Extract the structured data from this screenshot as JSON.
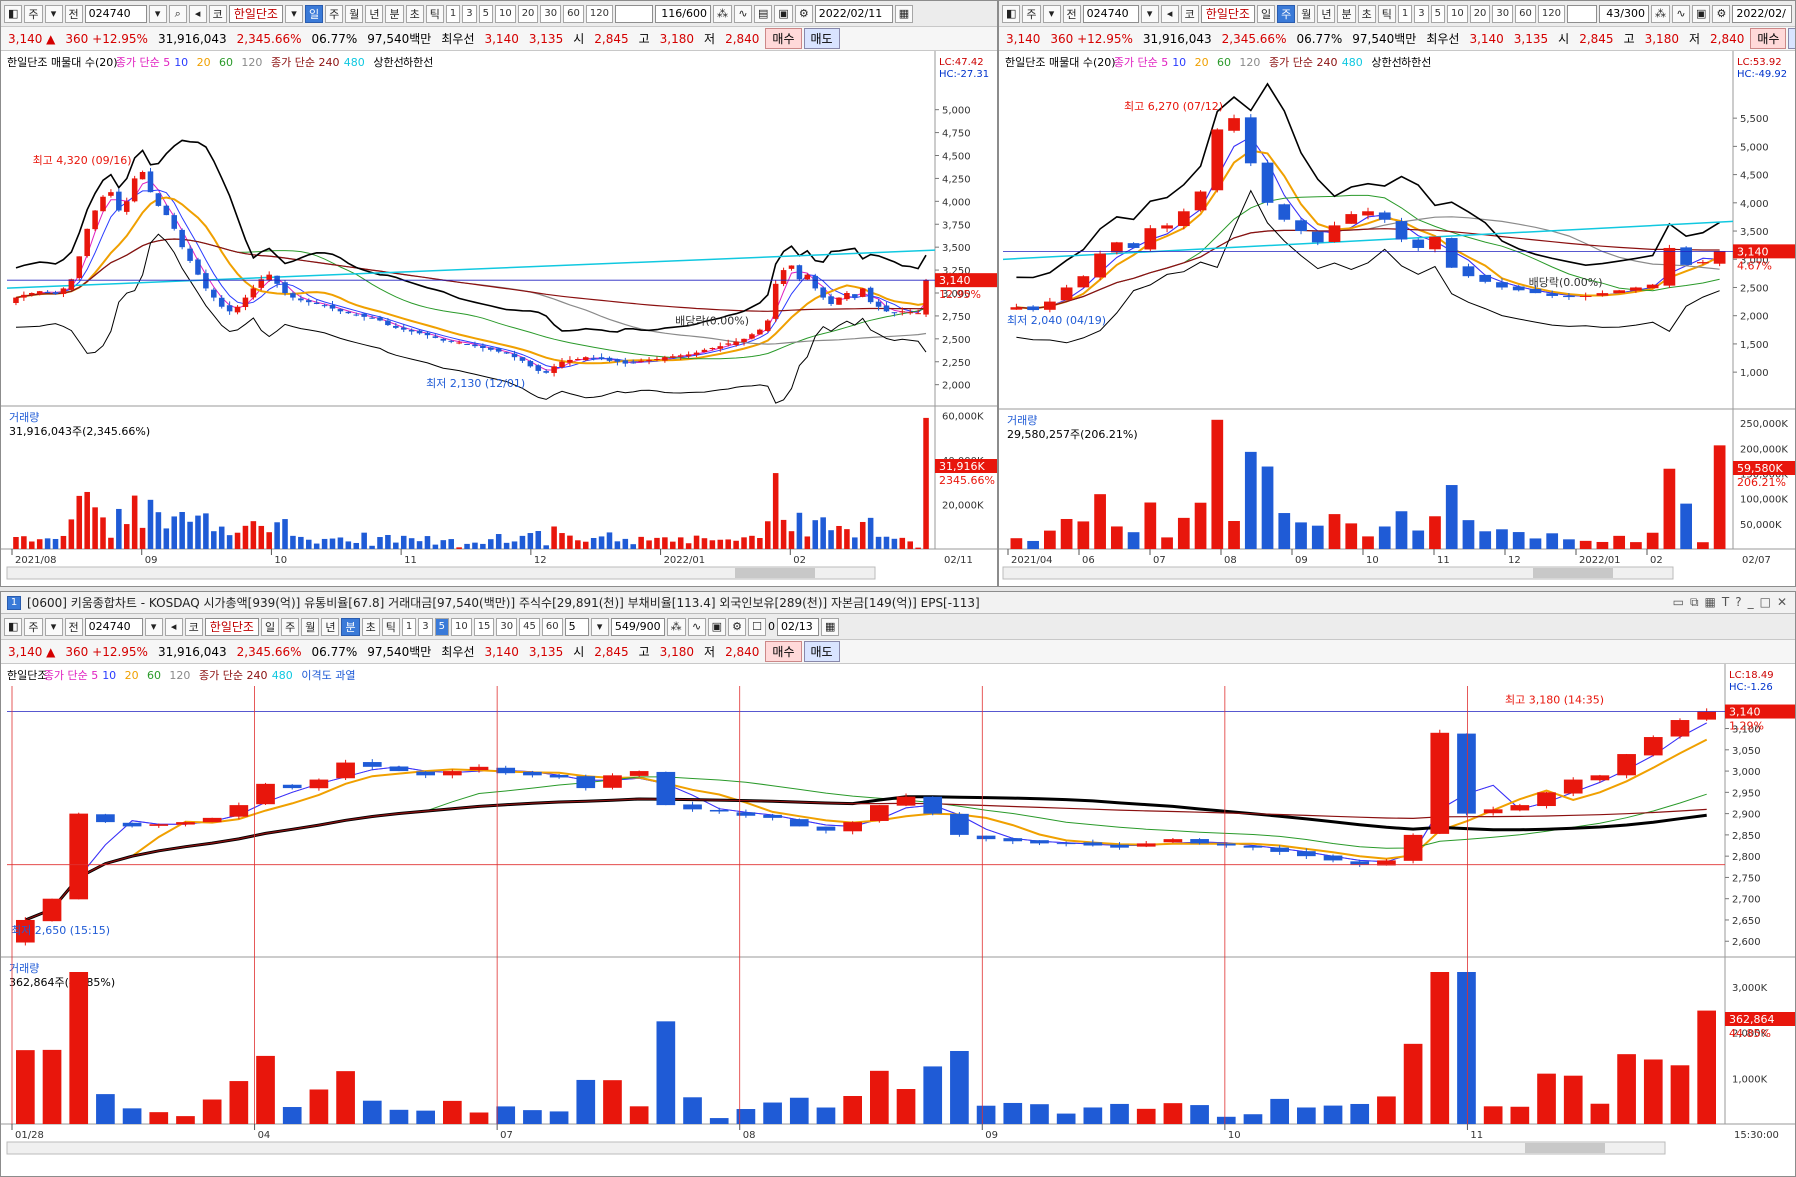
{
  "quote": {
    "price": "3,140",
    "change": "360",
    "change_pct": "+12.95%",
    "volume": "31,916,043",
    "vol_ratio": "2,345.66%",
    "turnover": "06.77%",
    "amount": "97,540백만",
    "best_label": "최우선",
    "ask": "3,140",
    "bid": "3,135",
    "open_label": "시",
    "open": "2,845",
    "high_label": "고",
    "high": "3,180",
    "low_label": "저",
    "low": "2,840",
    "buy": "매수",
    "sell": "매도"
  },
  "toolbar": {
    "main": "주",
    "all": "전",
    "code": "024740",
    "market": "코",
    "name": "한일단조",
    "periods": [
      "일",
      "주",
      "월",
      "년",
      "분",
      "초",
      "틱"
    ],
    "nums_w1": [
      "1",
      "3",
      "5",
      "10",
      "20",
      "30",
      "60",
      "120"
    ],
    "nums_w3": [
      "1",
      "3",
      "5",
      "10",
      "15",
      "30",
      "45",
      "60"
    ]
  },
  "win1": {
    "count": "116/600",
    "date": "2022/02/11"
  },
  "win2": {
    "count": "43/300",
    "date": "2022/02/"
  },
  "win3": {
    "count": "549/900",
    "date": "02/13",
    "interval": "5",
    "check": "0"
  },
  "title_bar": {
    "num": "1",
    "text": "[0600] 키움종합차트 - KOSDAQ 시가총액[939(억)] 유통비율[67.8] 거래대금[97,540(백만)] 주식수[29,891(천)] 부채비율[113.4] 외국인보유[289(천)] 자본금[149(억)] EPS[-113]"
  },
  "colors": {
    "up": "#e8160c",
    "down": "#1f5bd6",
    "ma5": "#e020c0",
    "ma10": "#2a3cff",
    "ma20": "#f0a000",
    "ma60": "#2a9a2a",
    "ma120": "#8a8a8a",
    "ma240": "#8b1010",
    "ma480": "#10c8e0",
    "bb": "#000000"
  },
  "chart_data": [
    {
      "type": "candlestick",
      "panel": "daily",
      "legend": [
        {
          "text": "한일단조 매물대 수(20)",
          "color": "#000000"
        },
        {
          "text": "종가 단순 5",
          "color": "#e020c0"
        },
        {
          "text": "10",
          "color": "#2a3cff"
        },
        {
          "text": "20",
          "color": "#f0a000"
        },
        {
          "text": "60",
          "color": "#2a9a2a"
        },
        {
          "text": "120",
          "color": "#8a8a8a"
        },
        {
          "text": "종가 단순 240",
          "color": "#8b1010"
        },
        {
          "text": "480",
          "color": "#10c8e0"
        },
        {
          "text": "상한선",
          "color": "#000000"
        },
        {
          "text": "하한선",
          "color": "#000000"
        }
      ],
      "ylim": [
        1800,
        5400
      ],
      "yticks": [
        "5,000",
        "4,750",
        "4,500",
        "4,250",
        "4,000",
        "3,750",
        "3,500",
        "3,250",
        "3,000",
        "2,750",
        "2,500",
        "2,250",
        "2,000"
      ],
      "ytick_values": [
        5000,
        4750,
        4500,
        4250,
        4000,
        3750,
        3500,
        3250,
        3000,
        2750,
        2500,
        2250,
        2000
      ],
      "xticks": [
        "2021/08",
        "09",
        "10",
        "11",
        "12",
        "2022/01",
        "02",
        "02/11"
      ],
      "lc": "LC:47.42",
      "hc": "HC:-27.31",
      "price_tag": "3,140",
      "pct_tag": "12.95%",
      "annotations": {
        "high": "최고 4,320 (09/16)",
        "low": "최저 2,130 (12/01)",
        "dividend": "배당락(0.00%)"
      },
      "closes": [
        2950,
        2980,
        3000,
        3020,
        3010,
        2990,
        3050,
        3150,
        3400,
        3700,
        3900,
        4050,
        4100,
        3900,
        4000,
        4250,
        4320,
        4100,
        3950,
        3850,
        3700,
        3500,
        3350,
        3200,
        3050,
        2950,
        2850,
        2800,
        2850,
        2950,
        3050,
        3150,
        3200,
        3100,
        3000,
        2950,
        2920,
        2900,
        2880,
        2860,
        2830,
        2800,
        2780,
        2760,
        2740,
        2720,
        2700,
        2650,
        2620,
        2600,
        2580,
        2560,
        2540,
        2510,
        2480,
        2470,
        2460,
        2440,
        2420,
        2400,
        2380,
        2360,
        2340,
        2300,
        2260,
        2200,
        2150,
        2130,
        2200,
        2250,
        2270,
        2280,
        2300,
        2290,
        2280,
        2260,
        2250,
        2230,
        2240,
        2260,
        2270,
        2280,
        2300,
        2310,
        2320,
        2330,
        2350,
        2380,
        2400,
        2420,
        2450,
        2470,
        2500,
        2550,
        2600,
        2700,
        3100,
        3250,
        3300,
        3150,
        3200,
        3050,
        2950,
        2880,
        2950,
        3000,
        2950,
        3050,
        2900,
        2850,
        2800,
        2780,
        2800,
        2790,
        2780,
        3140
      ],
      "volume": {
        "label": "거래량",
        "sub": "31,916,043주(2,345.66%)",
        "yticks": [
          "60,000K",
          "40,000K",
          "20,000K"
        ],
        "ytick_values": [
          60000,
          40000,
          20000
        ],
        "ymax": 62000,
        "tag": "31,916K",
        "tag2": "2345.66%"
      }
    },
    {
      "type": "candlestick",
      "panel": "weekly",
      "legend": [
        {
          "text": "한일단조 매물대 수(20)",
          "color": "#000000"
        },
        {
          "text": "종가 단순 5",
          "color": "#e020c0"
        },
        {
          "text": "10",
          "color": "#2a3cff"
        },
        {
          "text": "20",
          "color": "#f0a000"
        },
        {
          "text": "60",
          "color": "#2a9a2a"
        },
        {
          "text": "120",
          "color": "#8a8a8a"
        },
        {
          "text": "종가 단순 240",
          "color": "#8b1010"
        },
        {
          "text": "480",
          "color": "#10c8e0"
        },
        {
          "text": "상한선",
          "color": "#000000"
        },
        {
          "text": "하한선",
          "color": "#000000"
        }
      ],
      "ylim": [
        400,
        6300
      ],
      "yticks": [
        "5,500",
        "5,000",
        "4,500",
        "4,000",
        "3,500",
        "3,000",
        "2,500",
        "2,000",
        "1,500",
        "1,000"
      ],
      "ytick_values": [
        5500,
        5000,
        4500,
        4000,
        3500,
        3000,
        2500,
        2000,
        1500,
        1000
      ],
      "xticks": [
        "2021/04",
        "06",
        "07",
        "08",
        "09",
        "10",
        "11",
        "12",
        "2022/01",
        "02",
        "02/07"
      ],
      "lc": "LC:53.92",
      "hc": "HC:-49.92",
      "price_tag": "3,140",
      "pct_tag": "4.67%",
      "annotations": {
        "high": "최고 6,270 (07/12)",
        "low": "최저 2,040 (04/19)",
        "dividend": "배당락(0.00%)"
      },
      "closes": [
        2150,
        2100,
        2250,
        2500,
        2700,
        3100,
        3300,
        3200,
        3550,
        3600,
        3850,
        4200,
        5300,
        5500,
        4700,
        4000,
        3700,
        3500,
        3300,
        3600,
        3800,
        3850,
        3700,
        3350,
        3200,
        3400,
        2850,
        2700,
        2600,
        2500,
        2450,
        2400,
        2350,
        2330,
        2350,
        2400,
        2450,
        2500,
        2550,
        3200,
        2900,
        2950,
        3140
      ],
      "volume": {
        "label": "거래량",
        "sub": "29,580,257주(206.21%)",
        "yticks": [
          "250,000K",
          "200,000K",
          "150,000K",
          "100,000K",
          "50,000K"
        ],
        "ytick_values": [
          250000,
          200000,
          150000,
          100000,
          50000
        ],
        "ymax": 270000,
        "tag": "59,580K",
        "tag2": "206.21%"
      }
    },
    {
      "type": "candlestick",
      "panel": "5min",
      "legend": [
        {
          "text": "한일단조",
          "color": "#000000"
        },
        {
          "text": "종가 단순 5",
          "color": "#e020c0"
        },
        {
          "text": "10",
          "color": "#2a3cff"
        },
        {
          "text": "20",
          "color": "#f0a000"
        },
        {
          "text": "60",
          "color": "#2a9a2a"
        },
        {
          "text": "120",
          "color": "#8a8a8a"
        },
        {
          "text": "종가 단순 240",
          "color": "#8b1010"
        },
        {
          "text": "480",
          "color": "#10c8e0"
        },
        {
          "text": "이격도 과열",
          "color": "#1f5bd6"
        }
      ],
      "ylim": [
        2570,
        3200
      ],
      "yticks": [
        "3,150",
        "3,100",
        "3,050",
        "3,000",
        "2,950",
        "2,900",
        "2,850",
        "2,800",
        "2,750",
        "2,700",
        "2,650",
        "2,600"
      ],
      "ytick_values": [
        3150,
        3100,
        3050,
        3000,
        2950,
        2900,
        2850,
        2800,
        2750,
        2700,
        2650,
        2600
      ],
      "xticks": [
        "01/28",
        "04",
        "07",
        "08",
        "09",
        "10",
        "11",
        "15:30:00"
      ],
      "lc": "LC:18.49",
      "hc": "HC:-1.26",
      "price_tag": "3,140",
      "pct_tag": "1.29%",
      "annotations": {
        "high": "최고 3,180 (14:35)",
        "low": "최저 2,650 (15:15)"
      },
      "closes": [
        2650,
        2700,
        2900,
        2880,
        2870,
        2875,
        2880,
        2890,
        2920,
        2970,
        2960,
        2980,
        3020,
        3010,
        3000,
        2990,
        3000,
        3010,
        2995,
        2990,
        2985,
        2960,
        2990,
        3000,
        2920,
        2910,
        2905,
        2895,
        2890,
        2870,
        2860,
        2880,
        2920,
        2940,
        2900,
        2850,
        2840,
        2835,
        2830,
        2830,
        2825,
        2820,
        2830,
        2840,
        2830,
        2825,
        2820,
        2810,
        2800,
        2790,
        2780,
        2790,
        2850,
        3090,
        2900,
        2910,
        2920,
        2950,
        2980,
        2990,
        3040,
        3080,
        3120,
        3140
      ],
      "volume": {
        "label": "거래량",
        "sub": "362,864주(44.85%)",
        "yticks": [
          "3,000K",
          "2,000K",
          "1,000K"
        ],
        "ytick_values": [
          3000,
          2000,
          1000
        ],
        "ymax": 3500,
        "tag": "362,864",
        "tag2": "44.85%"
      }
    }
  ]
}
